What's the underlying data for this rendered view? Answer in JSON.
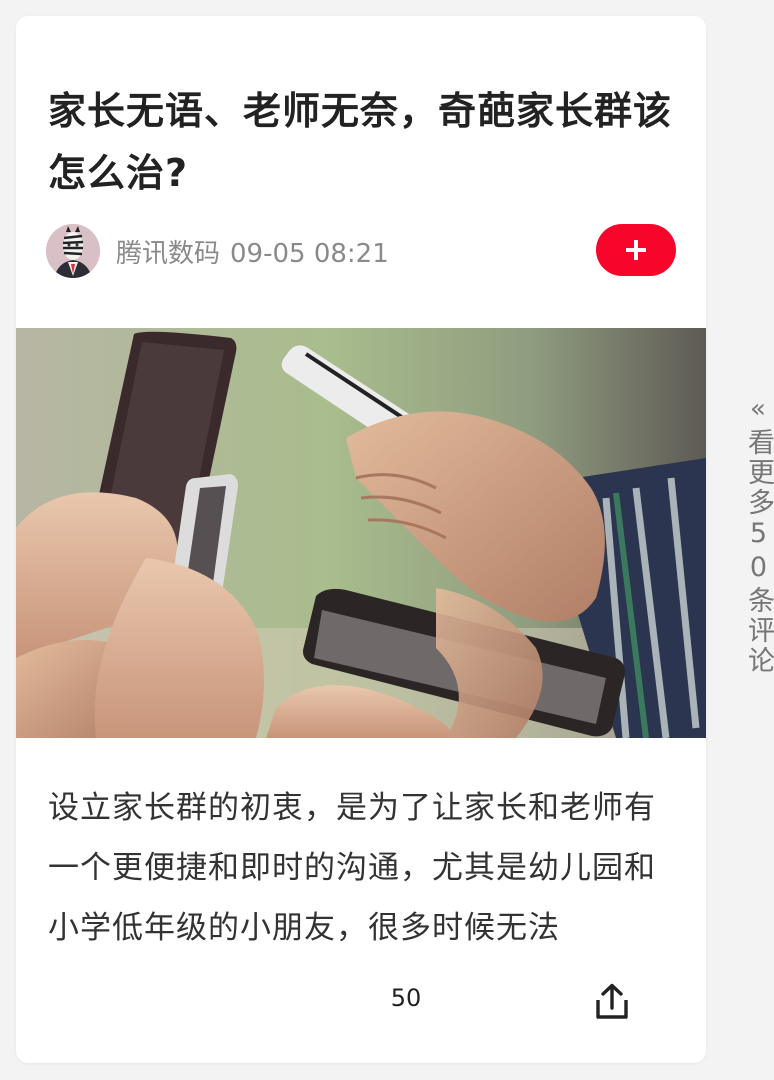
{
  "article": {
    "title": "家长无语、老师无奈，奇葩家长群该怎么治?",
    "source": "腾讯数码",
    "timestamp": "09-05 08:21",
    "summary": "设立家长群的初衷，是为了让家长和老师有一个更便捷和即时的沟通，尤其是幼儿园和小学低年级的小朋友，很多时候无法",
    "comment_count": "50"
  },
  "icons": {
    "follow": "plus-icon",
    "share": "share-icon",
    "more": "double-chevron-left-icon"
  },
  "side_panel": {
    "label": "看更多50条评论"
  },
  "colors": {
    "accent": "#f8052b",
    "title": "#222222",
    "meta": "#8a8a8a",
    "body": "#333333"
  }
}
